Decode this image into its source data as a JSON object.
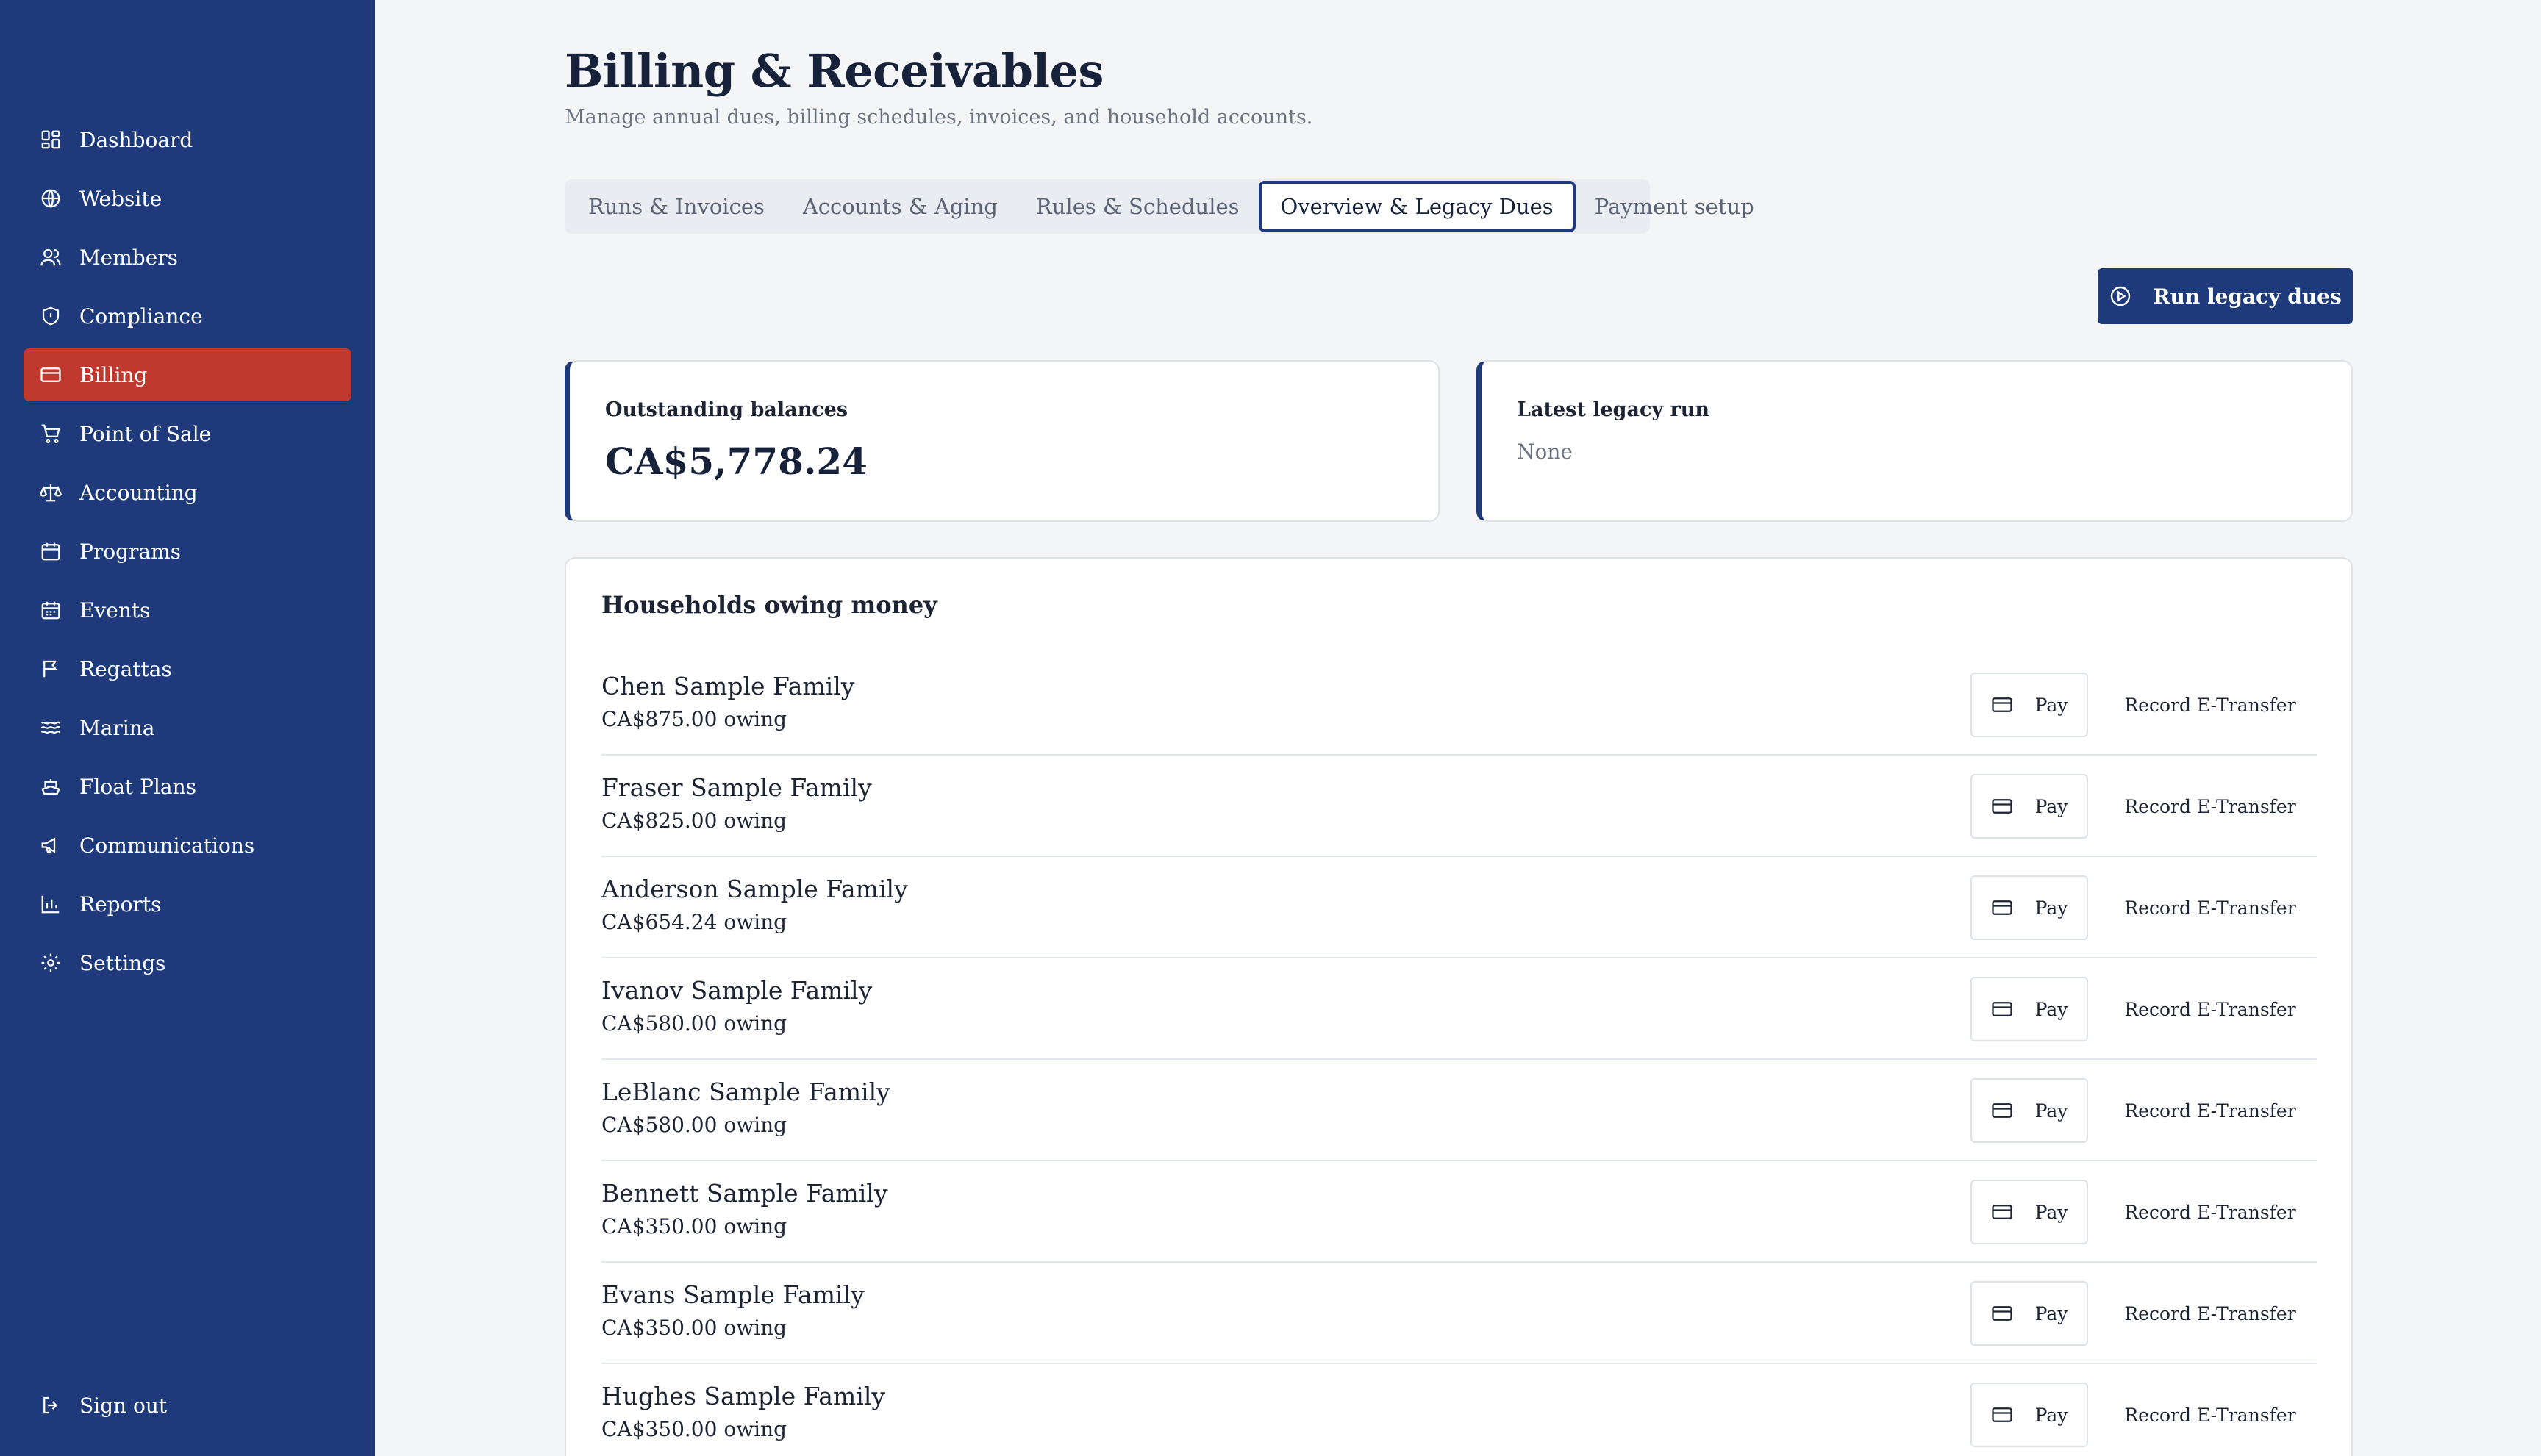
{
  "sidebar": {
    "items": [
      {
        "label": "Dashboard",
        "icon": "dashboard-icon"
      },
      {
        "label": "Website",
        "icon": "globe-icon"
      },
      {
        "label": "Members",
        "icon": "users-icon"
      },
      {
        "label": "Compliance",
        "icon": "shield-icon"
      },
      {
        "label": "Billing",
        "icon": "credit-card-icon",
        "active": true
      },
      {
        "label": "Point of Sale",
        "icon": "cart-icon"
      },
      {
        "label": "Accounting",
        "icon": "scale-icon"
      },
      {
        "label": "Programs",
        "icon": "calendar-icon"
      },
      {
        "label": "Events",
        "icon": "calendar-days-icon"
      },
      {
        "label": "Regattas",
        "icon": "flag-icon"
      },
      {
        "label": "Marina",
        "icon": "waves-icon"
      },
      {
        "label": "Float Plans",
        "icon": "ship-icon"
      },
      {
        "label": "Communications",
        "icon": "megaphone-icon"
      },
      {
        "label": "Reports",
        "icon": "bar-chart-icon"
      },
      {
        "label": "Settings",
        "icon": "gear-icon"
      }
    ],
    "sign_out": "Sign out"
  },
  "header": {
    "title": "Billing & Receivables",
    "subtitle": "Manage annual dues, billing schedules, invoices, and household accounts."
  },
  "tabs": [
    {
      "label": "Runs & Invoices"
    },
    {
      "label": "Accounts & Aging"
    },
    {
      "label": "Rules & Schedules"
    },
    {
      "label": "Overview & Legacy Dues",
      "active": true
    },
    {
      "label": "Payment setup"
    }
  ],
  "actions": {
    "run_legacy_dues": "Run legacy dues"
  },
  "cards": {
    "outstanding": {
      "label": "Outstanding balances",
      "value": "CA$5,778.24"
    },
    "latest_run": {
      "label": "Latest legacy run",
      "value": "None"
    }
  },
  "households": {
    "title": "Households owing money",
    "pay_label": "Pay",
    "etransfer_label": "Record E-Transfer",
    "rows": [
      {
        "name": "Chen Sample Family",
        "owing": "CA$875.00 owing"
      },
      {
        "name": "Fraser Sample Family",
        "owing": "CA$825.00 owing"
      },
      {
        "name": "Anderson Sample Family",
        "owing": "CA$654.24 owing"
      },
      {
        "name": "Ivanov Sample Family",
        "owing": "CA$580.00 owing"
      },
      {
        "name": "LeBlanc Sample Family",
        "owing": "CA$580.00 owing"
      },
      {
        "name": "Bennett Sample Family",
        "owing": "CA$350.00 owing"
      },
      {
        "name": "Evans Sample Family",
        "owing": "CA$350.00 owing"
      },
      {
        "name": "Hughes Sample Family",
        "owing": "CA$350.00 owing"
      }
    ]
  },
  "colors": {
    "sidebar": "#1e3a7b",
    "active_nav": "#c0392e",
    "primary": "#1e3a7b",
    "background": "#f4f5f7"
  }
}
